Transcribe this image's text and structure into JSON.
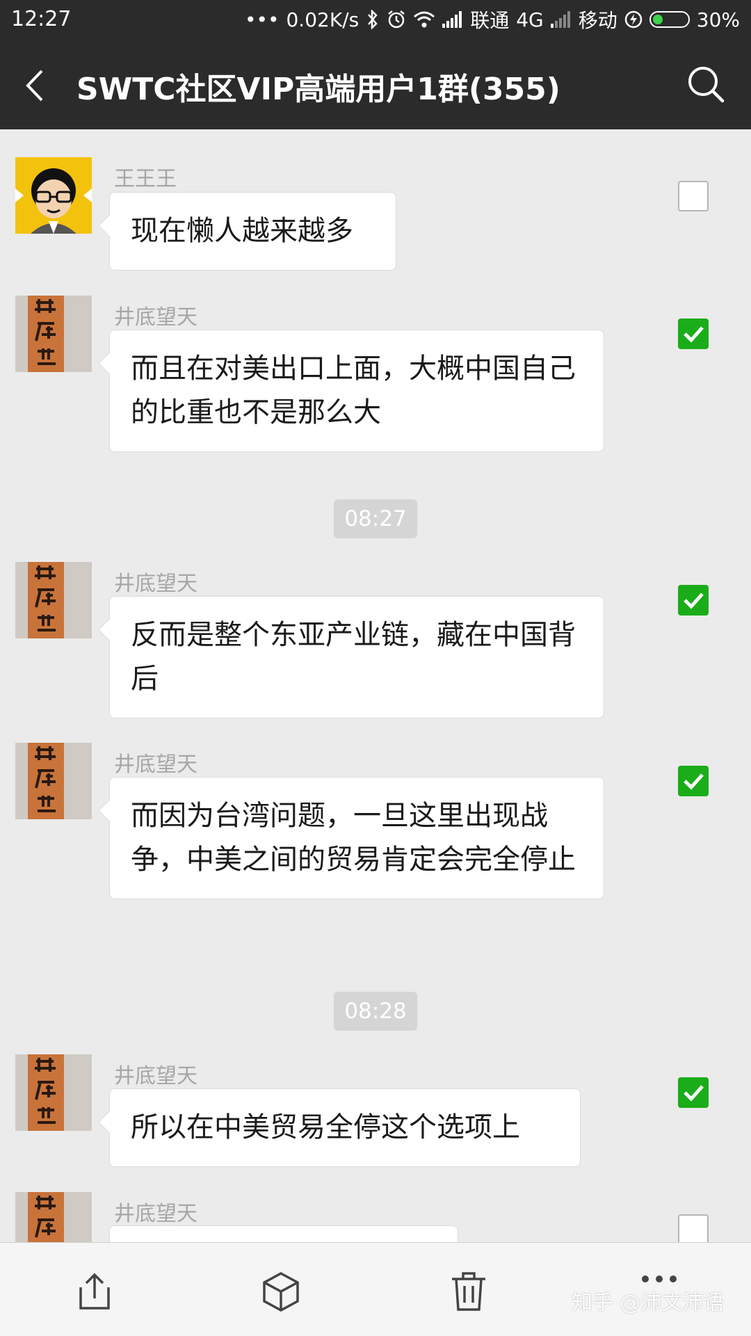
{
  "status_bar": {
    "time": "12:27",
    "speed": "0.02K/s",
    "carrier1": "联通",
    "network": "4G",
    "carrier2": "移动",
    "battery": "30%",
    "battery_level": 0.3
  },
  "header": {
    "title": "SWTC社区VIP高端用户1群(355)"
  },
  "messages": [
    {
      "sender": "王王王",
      "text": "现在懒人越来越多",
      "checked": false
    },
    {
      "sender": "井底望天",
      "text": "而且在对美出口上面，大概中国自己的比重也不是那么大",
      "checked": true
    },
    {
      "sender": "井底望天",
      "text": "反而是整个东亚产业链，藏在中国背后",
      "checked": true
    },
    {
      "sender": "井底望天",
      "text": "而因为台湾问题，一旦这里出现战争，中美之间的贸易肯定会完全停止",
      "checked": true
    },
    {
      "sender": "井底望天",
      "text": "所以在中美贸易全停这个选项上",
      "checked": true
    },
    {
      "sender": "井底望天",
      "text": "",
      "checked": false
    }
  ],
  "timestamps": [
    "08:27",
    "08:28"
  ],
  "watermark": "知乎 @沛文沛语",
  "colors": {
    "header_bg": "#2b2b2b",
    "chat_bg": "#ebebeb",
    "check_green": "#1aad19",
    "battery_green": "#3fd24b"
  },
  "icons": {
    "back": "chevron-left-icon",
    "search": "search-icon",
    "share": "share-icon",
    "favorite": "box-icon",
    "delete": "trash-icon",
    "more": "more-icon"
  }
}
